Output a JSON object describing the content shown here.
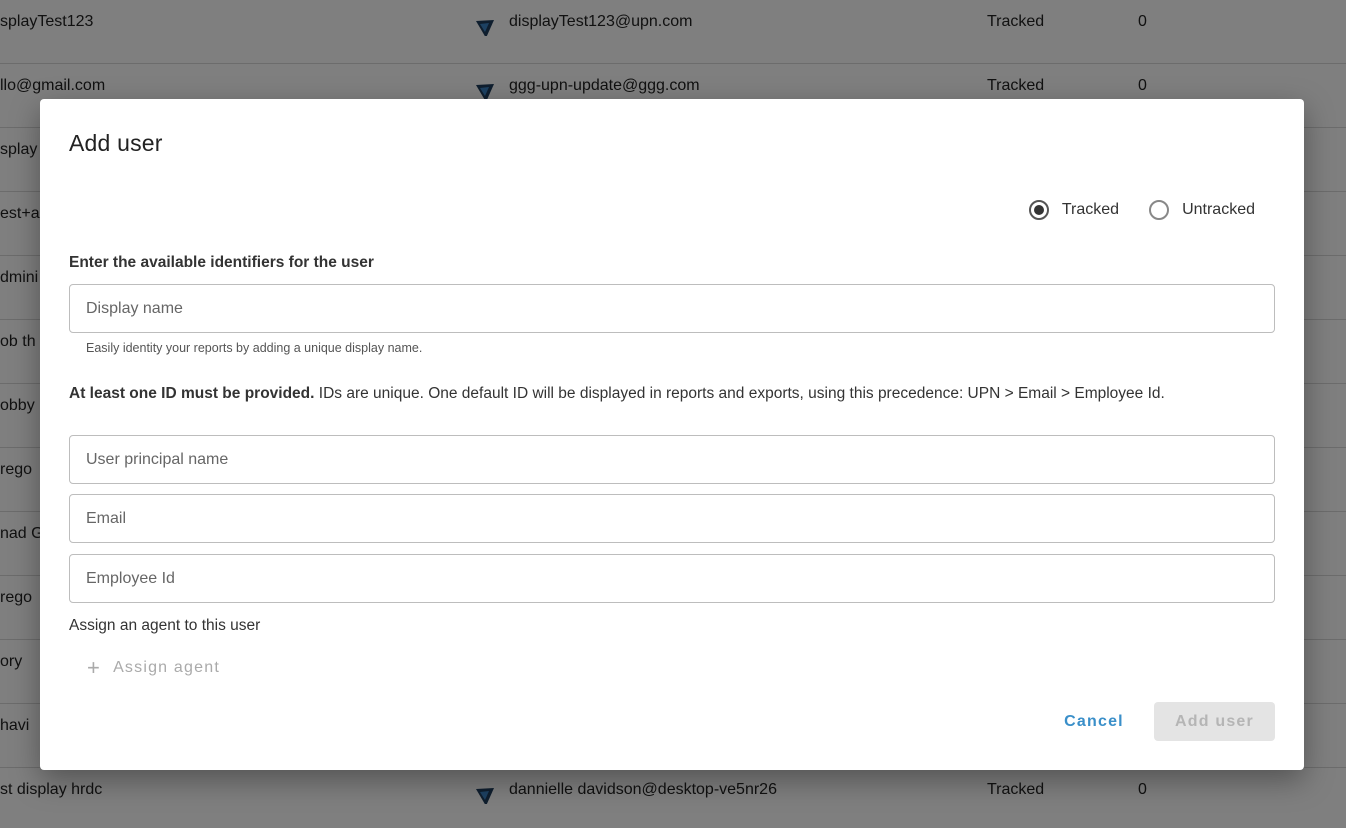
{
  "background_table": {
    "rows": [
      {
        "name": "splayTest123",
        "upn": "displayTest123@upn.com",
        "status": "Tracked",
        "count": "0"
      },
      {
        "name": "llo@gmail.com",
        "upn": "ggg-upn-update@ggg.com",
        "status": "Tracked",
        "count": "0"
      },
      {
        "name": "splay",
        "upn": "",
        "status": "",
        "count": ""
      },
      {
        "name": "est+a",
        "upn": "",
        "status": "",
        "count": ""
      },
      {
        "name": "dmini",
        "upn": "",
        "status": "",
        "count": ""
      },
      {
        "name": "ob th",
        "upn": "",
        "status": "",
        "count": ""
      },
      {
        "name": "obby",
        "upn": "",
        "status": "",
        "count": ""
      },
      {
        "name": "rego",
        "upn": "",
        "status": "",
        "count": ""
      },
      {
        "name": "nad G",
        "upn": "",
        "status": "",
        "count": ""
      },
      {
        "name": "rego",
        "upn": "",
        "status": "",
        "count": ""
      },
      {
        "name": "ory",
        "upn": "",
        "status": "",
        "count": ""
      },
      {
        "name": "havi",
        "upn": "",
        "status": "",
        "count": ""
      },
      {
        "name": "st display hrdc",
        "upn": "dannielle davidson@desktop-ve5nr26",
        "status": "Tracked",
        "count": "0"
      }
    ]
  },
  "dialog": {
    "title": "Add user",
    "tracking": {
      "options": [
        "Tracked",
        "Untracked"
      ],
      "selected": "Tracked"
    },
    "identifiers_label": "Enter the available identifiers for the user",
    "display_name": {
      "value": "",
      "placeholder": "Display name"
    },
    "display_name_helper": "Easily identity your reports by adding a unique display name.",
    "notice_bold": "At least one ID must be provided.",
    "notice_rest": " IDs are unique. One default ID will be displayed in reports and exports, using this precedence: UPN > Email > Employee Id.",
    "upn": {
      "value": "",
      "placeholder": "User principal name"
    },
    "email": {
      "value": "",
      "placeholder": "Email"
    },
    "employee_id": {
      "value": "",
      "placeholder": "Employee Id"
    },
    "assign_label": "Assign an agent to this user",
    "assign_button": "Assign agent",
    "cancel_button": "Cancel",
    "add_button": "Add user"
  },
  "colors": {
    "accent": "#3a8fc9",
    "disabled_bg": "#e4e4e4",
    "disabled_text": "#b5b5b5",
    "icon_dark": "#1f3d5c"
  }
}
